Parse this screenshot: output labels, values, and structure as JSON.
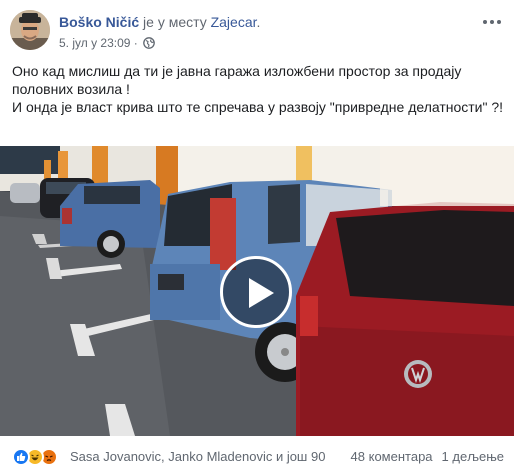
{
  "post": {
    "author": "Boško Ničić",
    "location_prefix": "је у месту",
    "location": "Zajecar",
    "location_suffix": ".",
    "timestamp": "5. јул у 23:09 ·",
    "privacy_icon": "globe-icon",
    "more_icon": "more-options-icon",
    "text_lines": [
      "Оно кад мислиш да ти је јавна гаража изложбени простор за продају половних возила !",
      "И онда је власт крива што те спречава у развоју \"привредне делатности\" ?!"
    ]
  },
  "video": {
    "play_icon": "play-icon"
  },
  "footer": {
    "reaction_icons": [
      "like-icon",
      "haha-icon",
      "angry-icon"
    ],
    "reaction_names": "Sasa Jovanovic, Janko Mladenovic и још 90",
    "comments": "48 коментара",
    "shares": "1 дељење"
  },
  "colors": {
    "link": "#385898",
    "meta": "#606770",
    "like": "#1877f2",
    "haha": "#f7b928",
    "angry": "#e9710f"
  }
}
